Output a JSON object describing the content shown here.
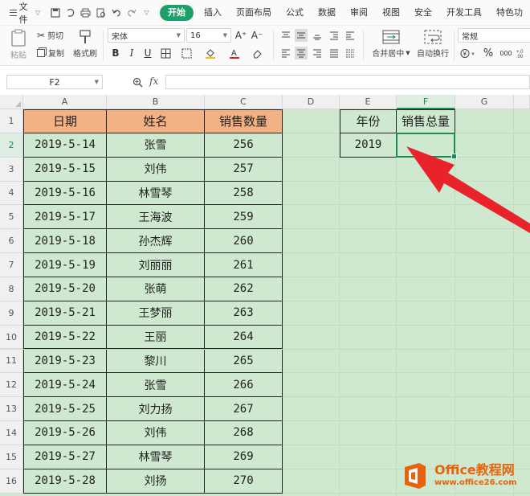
{
  "menubar": {
    "file_label": "文件",
    "tabs": [
      {
        "label": "开始",
        "active": true
      },
      {
        "label": "插入"
      },
      {
        "label": "页面布局"
      },
      {
        "label": "公式"
      },
      {
        "label": "数据"
      },
      {
        "label": "审阅"
      },
      {
        "label": "视图"
      },
      {
        "label": "安全"
      },
      {
        "label": "开发工具"
      },
      {
        "label": "特色功"
      }
    ]
  },
  "ribbon": {
    "paste_label": "粘贴",
    "cut_label": "剪切",
    "copy_label": "复制",
    "format_painter_label": "格式刷",
    "font_name": "宋体",
    "font_size": "16",
    "grow_font": "A⁺",
    "shrink_font": "A⁻",
    "bold": "B",
    "italic": "I",
    "underline": "U",
    "merge_label": "合并居中",
    "wrap_label": "自动换行",
    "number_format": "常规",
    "percent": "%",
    "thousands": "000"
  },
  "formula_bar": {
    "name_box": "F2",
    "fx_label": "fx",
    "formula": ""
  },
  "grid": {
    "columns": [
      "A",
      "B",
      "C",
      "D",
      "E",
      "F",
      "G"
    ],
    "selected_column": "F",
    "selected_row": "2",
    "rows": [
      "1",
      "2",
      "3",
      "4",
      "5",
      "6",
      "7",
      "8",
      "9",
      "10",
      "11",
      "12",
      "13",
      "14",
      "15",
      "16"
    ],
    "table_headers": {
      "date": "日期",
      "name": "姓名",
      "qty": "销售数量"
    },
    "table_rows": [
      {
        "date": "2019-5-14",
        "name": "张雪",
        "qty": "256"
      },
      {
        "date": "2019-5-15",
        "name": "刘伟",
        "qty": "257"
      },
      {
        "date": "2019-5-16",
        "name": "林雪琴",
        "qty": "258"
      },
      {
        "date": "2019-5-17",
        "name": "王海波",
        "qty": "259"
      },
      {
        "date": "2019-5-18",
        "name": "孙杰辉",
        "qty": "260"
      },
      {
        "date": "2019-5-19",
        "name": "刘丽丽",
        "qty": "261"
      },
      {
        "date": "2019-5-20",
        "name": "张萌",
        "qty": "262"
      },
      {
        "date": "2019-5-21",
        "name": "王梦丽",
        "qty": "263"
      },
      {
        "date": "2019-5-22",
        "name": "王丽",
        "qty": "264"
      },
      {
        "date": "2019-5-23",
        "name": "黎川",
        "qty": "265"
      },
      {
        "date": "2019-5-24",
        "name": "张雪",
        "qty": "266"
      },
      {
        "date": "2019-5-25",
        "name": "刘力扬",
        "qty": "267"
      },
      {
        "date": "2019-5-26",
        "name": "刘伟",
        "qty": "268"
      },
      {
        "date": "2019-5-27",
        "name": "林雪琴",
        "qty": "269"
      },
      {
        "date": "2019-5-28",
        "name": "刘扬",
        "qty": "270"
      }
    ],
    "side_table": {
      "year_label": "年份",
      "total_label": "销售总量",
      "year_value": "2019",
      "total_value": ""
    }
  },
  "watermark": {
    "brand": "Office教程网",
    "url": "www.office26.com"
  },
  "colors": {
    "accent": "#1da06a",
    "header_fill": "#f4b183",
    "sheet_fill": "#cfe8d0",
    "arrow": "#e8232a",
    "watermark": "#e8640c"
  }
}
